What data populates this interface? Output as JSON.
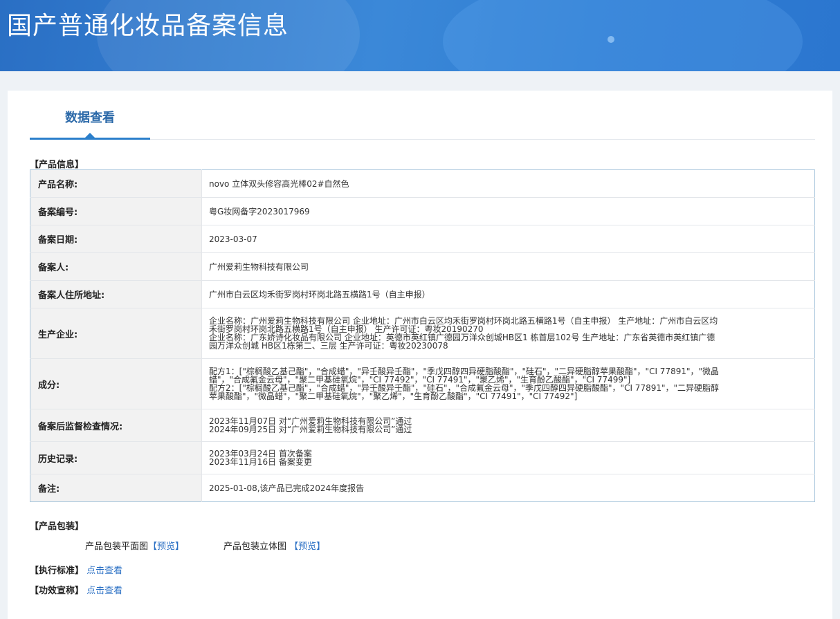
{
  "header": {
    "title": "国产普通化妆品备案信息"
  },
  "tabs": [
    {
      "label": "数据查看"
    }
  ],
  "product_info": {
    "section_title": "【产品信息】",
    "rows": [
      {
        "label": "产品名称:",
        "lines": [
          "novo 立体双头修容高光棒02#自然色"
        ]
      },
      {
        "label": "备案编号:",
        "lines": [
          "粤G妆网备字2023017969"
        ]
      },
      {
        "label": "备案日期:",
        "lines": [
          "2023-03-07"
        ]
      },
      {
        "label": "备案人:",
        "lines": [
          "广州爱莉生物科技有限公司"
        ]
      },
      {
        "label": "备案人住所地址:",
        "lines": [
          "广州市白云区均禾街罗岗村环岗北路五横路1号（自主申报）"
        ]
      },
      {
        "label": "生产企业:",
        "lines": [
          "企业名称：广州爱莉生物科技有限公司 企业地址：广州市白云区均禾街罗岗村环岗北路五横路1号（自主申报） 生产地址：广州市白云区均",
          "禾街罗岗村环岗北路五横路1号（自主申报） 生产许可证：粤妆20190270",
          "企业名称：广东娇诗化妆品有限公司 企业地址：英德市英红镇广德园万洋众创城HB区1 栋首层102号 生产地址：广东省英德市英红镇广德",
          "园万洋众创城 HB区1栋第二、三层 生产许可证：粤妆20230078"
        ]
      },
      {
        "label": "成分:",
        "lines": [
          "配方1：[\"棕榈酸乙基己酯\"，\"合成蜡\"，\"异壬酸异壬酯\"，\"季戊四醇四异硬脂酸酯\"，\"硅石\"，\"二异硬脂醇苹果酸酯\"，\"CI 77891\"，\"微晶",
          "蜡\"，\"合成氟金云母\"，\"聚二甲基硅氧烷\"，\"CI 77492\"，\"CI 77491\"，\"聚乙烯\"，\"生育酚乙酸酯\"，\"CI 77499\"]",
          "配方2：[\"棕榈酸乙基己酯\"，\"合成蜡\"，\"异壬酸异壬酯\"，\"硅石\"，\"合成氟金云母\"，\"季戊四醇四异硬脂酸酯\"，\"CI 77891\"，\"二异硬脂醇",
          "苹果酸酯\"，\"微晶蜡\"，\"聚二甲基硅氧烷\"，\"聚乙烯\"，\"生育酚乙酸酯\"，\"CI 77491\"，\"CI 77492\"]"
        ]
      },
      {
        "label": "备案后监督检查情况:",
        "lines": [
          "2023年11月07日 对“广州爱莉生物科技有限公司”通过",
          "2024年09月25日 对“广州爱莉生物科技有限公司”通过"
        ]
      },
      {
        "label": "历史记录:",
        "lines": [
          "2023年03月24日 首次备案",
          "2023年11月16日 备案变更"
        ]
      },
      {
        "label": "备注:",
        "lines": [
          "2025-01-08,该产品已完成2024年度报告"
        ]
      }
    ]
  },
  "packaging": {
    "section_title": "【产品包装】",
    "flat_label": "产品包装平面图",
    "flat_link": "【预览】",
    "solid_label": "产品包装立体图",
    "solid_link": "【预览】"
  },
  "standard": {
    "label": "【执行标准】",
    "link": "点击查看"
  },
  "efficacy": {
    "label": "【功效宣称】",
    "link": "点击查看"
  }
}
